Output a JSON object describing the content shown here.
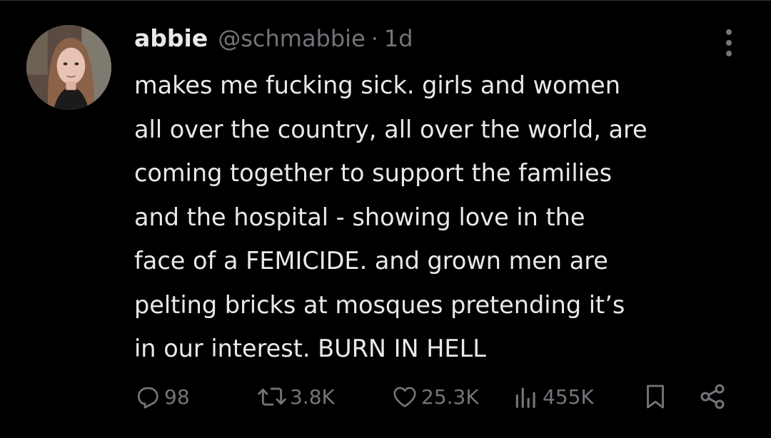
{
  "tweet": {
    "author": {
      "name": "abbie",
      "handle": "@schmabbie",
      "separator": "·",
      "time": "1d"
    },
    "text_lines": [
      "makes me fucking sick. girls and women",
      "all over the country, all over the world, are",
      "coming together to support the families",
      "and the hospital - showing love in the",
      "face of a FEMICIDE. and grown men are",
      "pelting bricks at mosques pretending it’s",
      "in our interest. BURN IN HELL"
    ],
    "stats": {
      "replies": "98",
      "retweets": "3.8K",
      "likes": "25.3K",
      "views": "455K"
    },
    "icons": {
      "reply": "reply-icon",
      "retweet": "retweet-icon",
      "like": "heart-icon",
      "views": "views-bar-chart-icon",
      "bookmark": "bookmark-icon",
      "share": "share-icon",
      "more": "more-vertical-icon"
    },
    "colors": {
      "background": "#000000",
      "text": "#e7e9ea",
      "secondary": "#71767b"
    }
  }
}
